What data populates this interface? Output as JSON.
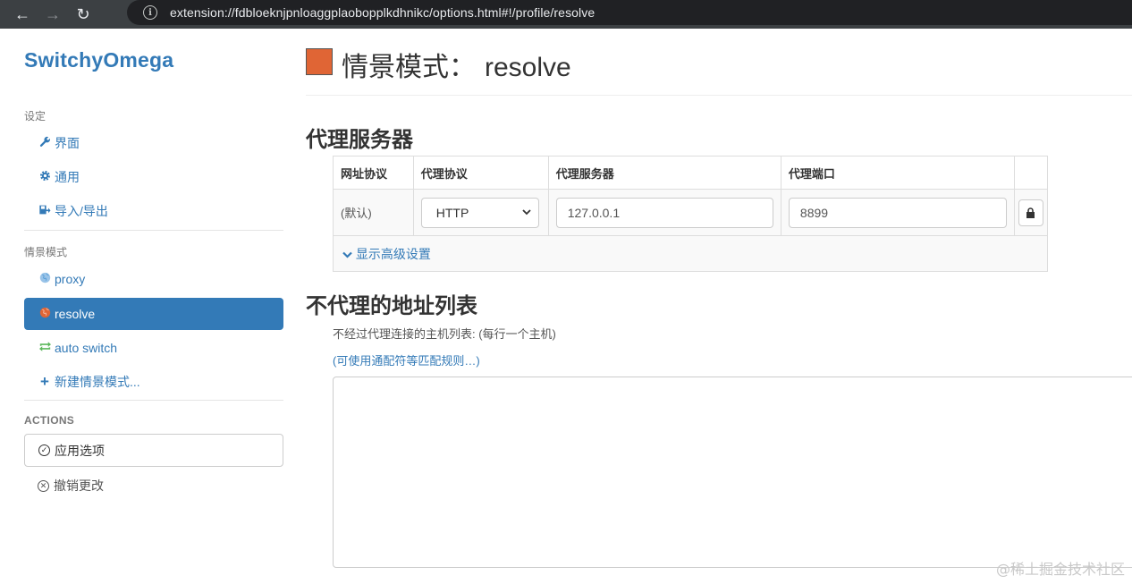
{
  "browser": {
    "back_icon": "←",
    "forward_icon": "→",
    "reload_icon": "↻",
    "info_icon": "i",
    "url": "extension://fdbloeknjpnloaggplaobopplkdhnikc/options.html#!/profile/resolve"
  },
  "sidebar": {
    "brand": "SwitchyOmega",
    "settings_header": "设定",
    "settings_items": [
      {
        "label": "界面",
        "icon": "wrench-icon"
      },
      {
        "label": "通用",
        "icon": "gear-icon"
      },
      {
        "label": "导入/导出",
        "icon": "import-export-icon"
      }
    ],
    "profiles_header": "情景模式",
    "profiles": [
      {
        "label": "proxy",
        "icon": "globe-icon",
        "active": false
      },
      {
        "label": "resolve",
        "icon": "globe-icon",
        "active": true
      },
      {
        "label": "auto switch",
        "icon": "auto-switch-icon",
        "active": false
      }
    ],
    "new_profile": "新建情景模式...",
    "actions_header": "ACTIONS",
    "apply": "应用选项",
    "discard": "撤销更改"
  },
  "main": {
    "title_prefix": "情景模式：",
    "profile_name": "resolve",
    "profile_color": "#e06535",
    "proxy_section_title": "代理服务器",
    "table": {
      "headers": [
        "网址协议",
        "代理协议",
        "代理服务器",
        "代理端口"
      ],
      "scheme": "(默认)",
      "protocol": "HTTP",
      "server": "127.0.0.1",
      "port": "8899"
    },
    "show_advanced": "显示高级设置",
    "bypass_section_title": "不代理的地址列表",
    "bypass_desc": "不经过代理连接的主机列表: (每行一个主机)",
    "bypass_link": "(可使用通配符等匹配规则…)",
    "bypass_value": ""
  },
  "watermark": "@稀土掘金技术社区",
  "colors": {
    "accent": "#337ab7",
    "browser_bar": "#3c4043",
    "url_bg": "#202124"
  }
}
